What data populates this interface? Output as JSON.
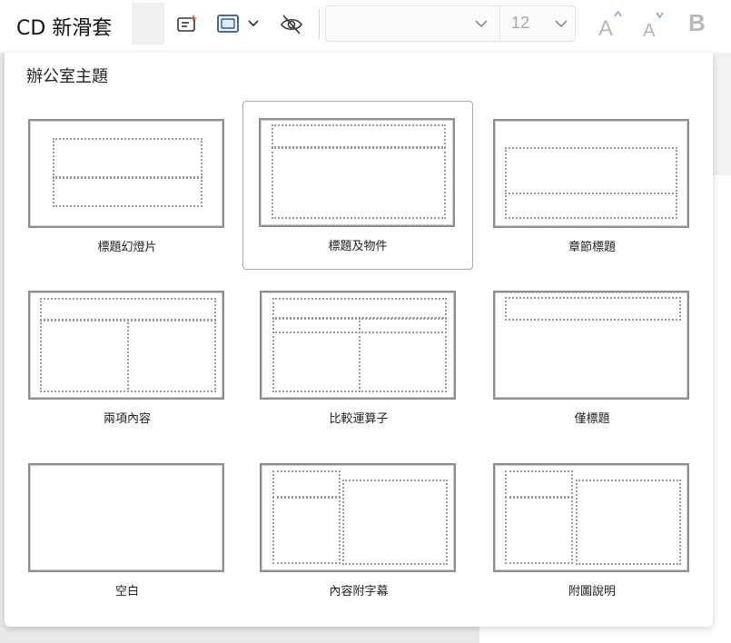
{
  "toolbar": {
    "new_slide_label": "CD 新滑套",
    "font_size": "12",
    "icons": [
      "designer-icon",
      "layout-icon",
      "chevron-down-icon",
      "hide-slide-icon",
      "grow-font-icon",
      "shrink-font-icon",
      "bold-icon"
    ]
  },
  "panel": {
    "title": "辦公室主題",
    "selected_layout": "標題及物件",
    "layouts": [
      {
        "label": "標題幻燈片"
      },
      {
        "label": "標題及物件"
      },
      {
        "label": "章節標題"
      },
      {
        "label": "兩項內容"
      },
      {
        "label": "比較運算子"
      },
      {
        "label": "僅標題"
      },
      {
        "label": "空白"
      },
      {
        "label": "內容附字幕"
      },
      {
        "label": "附圖說明"
      }
    ]
  },
  "colors": {
    "accent_icon": "#2b579a",
    "selection_border": "#a9a9a9"
  }
}
